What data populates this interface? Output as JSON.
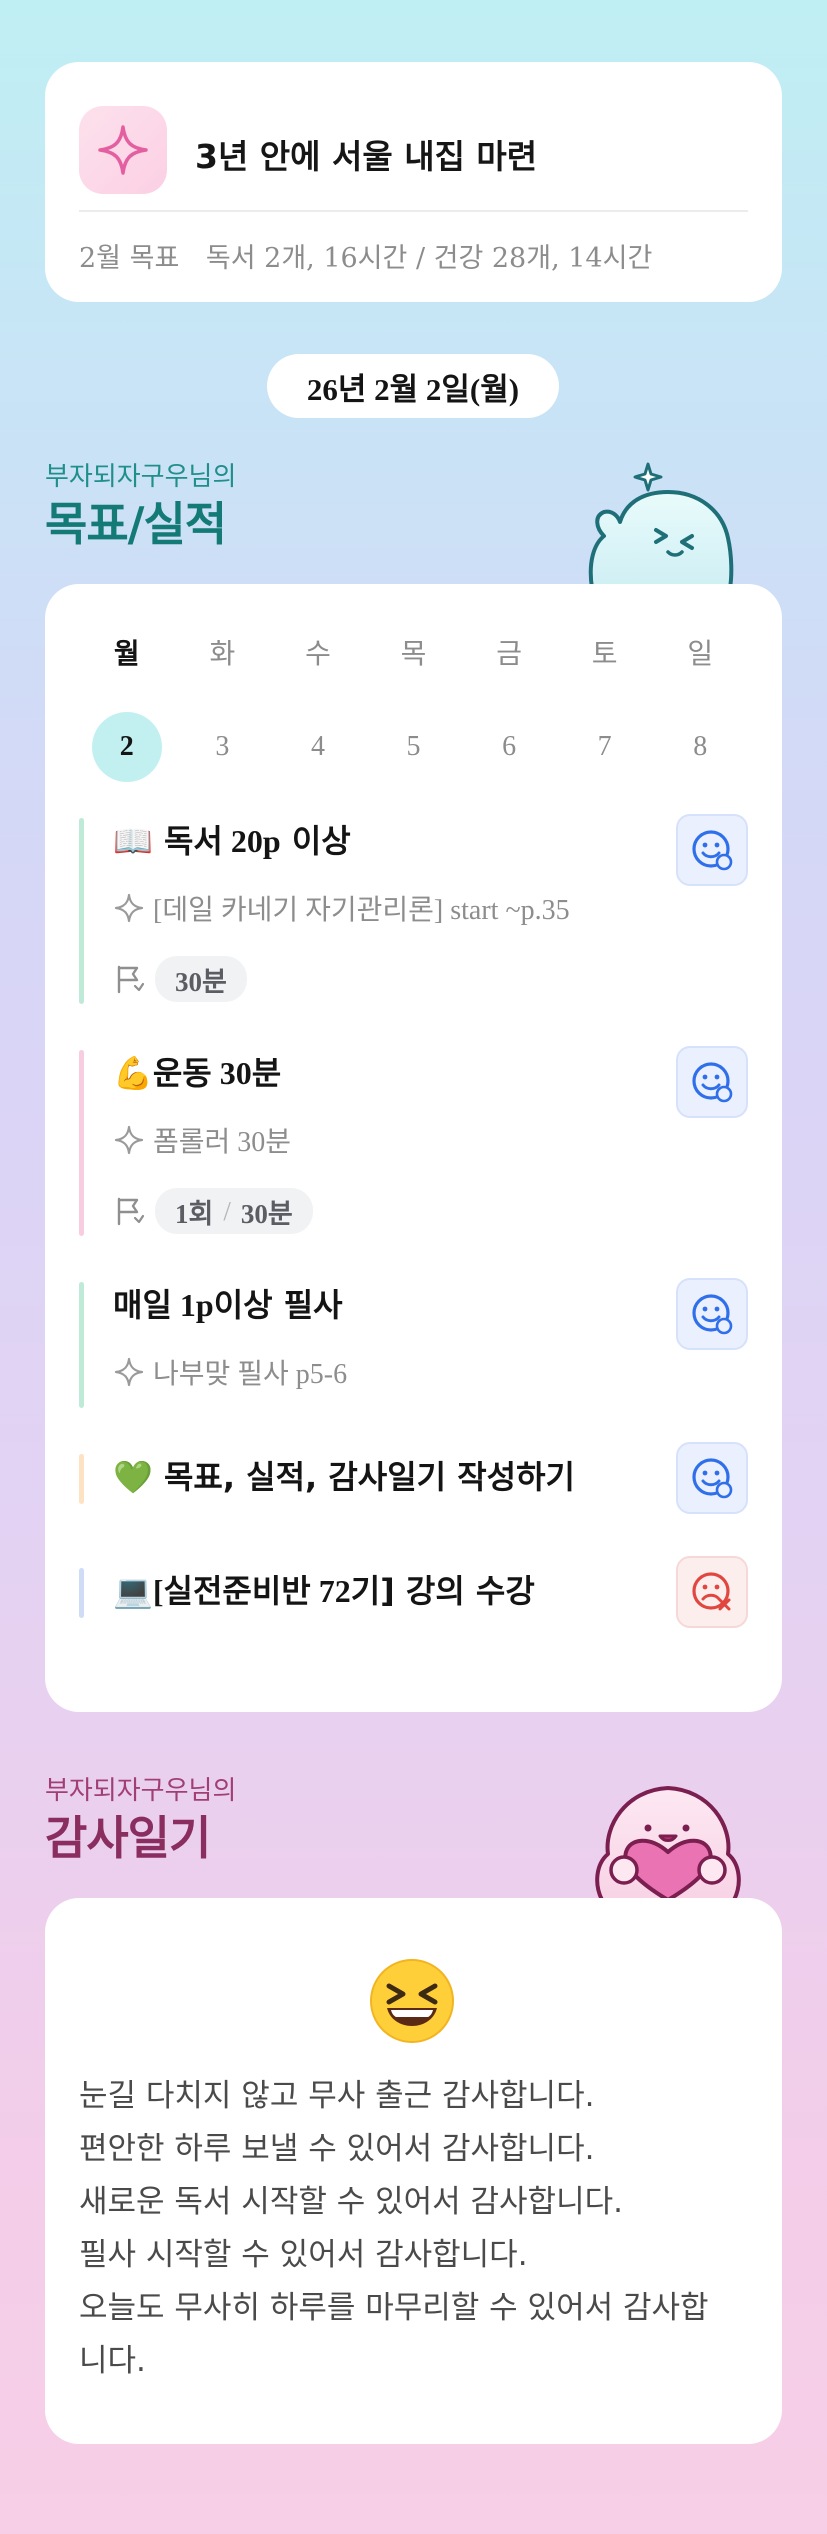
{
  "goal": {
    "title": "3년 안에 서울 내집 마련",
    "month_label": "2월 목표",
    "month_detail": "독서 2개, 16시간 / 건강 28개, 14시간",
    "icon": "sparkle-icon"
  },
  "date_label": "26년 2월 2일(월)",
  "goals_section": {
    "owner": "부자되자구우님의",
    "title": "목표/실적"
  },
  "week": {
    "days": [
      "월",
      "화",
      "수",
      "목",
      "금",
      "토",
      "일"
    ],
    "dates": [
      "2",
      "3",
      "4",
      "5",
      "6",
      "7",
      "8"
    ],
    "selected_index": 0
  },
  "tasks": [
    {
      "emoji": "📖",
      "title_a": "독서",
      "title_b": " 20p",
      "title_c": " 이상",
      "note": "[데일 카네기 자기관리론] start ~p.35",
      "chip_a": "30분",
      "chip_b": "",
      "status": "smile",
      "bar_color": "#bfead8"
    },
    {
      "emoji": "💪",
      "title_a": "운동",
      "title_b": " 30",
      "title_c": "분",
      "note": "폼롤러 30분",
      "chip_a": "1회",
      "chip_b": "30분",
      "status": "smile",
      "bar_color": "#f9cde0"
    },
    {
      "emoji": "",
      "title_a": "매일",
      "title_b": " 1p",
      "title_c": "이상 필사",
      "note": "나부맞 필사 p5-6",
      "status": "smile",
      "bar_color": "#bfead8"
    },
    {
      "emoji": "💚",
      "title_a": "목표, 실적, 감사일기 작성하기",
      "title_b": "",
      "title_c": "",
      "status": "smile",
      "bar_color": "#fde2c4"
    },
    {
      "emoji": "💻",
      "title_a": "[실전준비반",
      "title_b": " 72",
      "title_c": "기] 강의 수강",
      "status": "sad",
      "bar_color": "#d0dcf5"
    }
  ],
  "gratitude_section": {
    "owner": "부자되자구우님의",
    "title": "감사일기"
  },
  "gratitude": {
    "emoji": "grinning-squint-emoji",
    "lines": [
      "눈길 다치지 않고 무사 출근 감사합니다.",
      "편안한 하루 보낼 수 있어서 감사합니다.",
      "새로운 독서 시작할 수 있어서 감사합니다.",
      "필사 시작할 수 있어서 감사합니다.",
      "오늘도 무사히 하루를 마무리할 수 있어서 감사합",
      "니다."
    ]
  },
  "colors": {
    "accent_teal": "#137a76",
    "accent_plum": "#8a2d5f",
    "status_ok": "#2f6fea",
    "status_no": "#e0483f",
    "selected_day": "#c2f0f1"
  }
}
